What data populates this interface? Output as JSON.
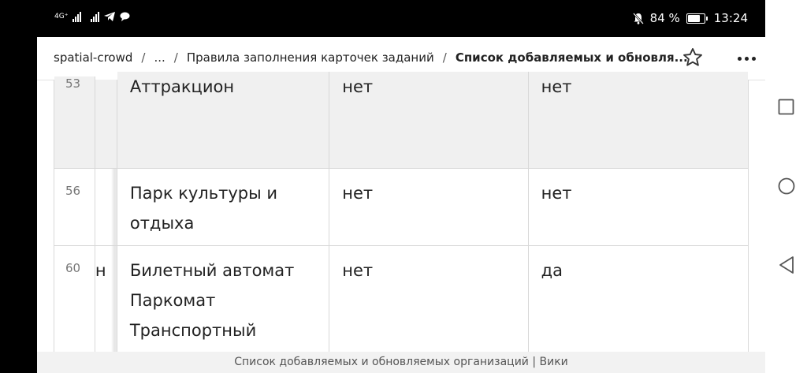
{
  "status_bar": {
    "network": "4G⁺",
    "battery_percent": "84 %",
    "battery_level": 0.84,
    "time": "13:24"
  },
  "header": {
    "breadcrumbs": [
      "spatial-crowd",
      "...",
      "Правила заполнения карточек заданий",
      "Список добавляемых и обновля..."
    ],
    "star_icon": "star-outline-icon",
    "more_icon": "more-horizontal-icon"
  },
  "table": {
    "rows": [
      {
        "num": "53",
        "prev": "",
        "name_lines": [
          "Аттракцион"
        ],
        "a": "нет",
        "b": "нет"
      },
      {
        "num": "56",
        "prev": "",
        "name_lines": [
          "Парк культуры и",
          "отдыха"
        ],
        "a": "нет",
        "b": "нет"
      },
      {
        "num": "60",
        "prev": "н",
        "name_lines": [
          "Билетный автомат",
          "Паркомат",
          "Транспортный"
        ],
        "a": "нет",
        "b": "да"
      }
    ]
  },
  "footer": {
    "title": "Список добавляемых и обновляемых организаций | Вики"
  },
  "nav": {
    "recent_icon": "square-icon",
    "home_icon": "circle-icon",
    "back_icon": "triangle-back-icon"
  }
}
